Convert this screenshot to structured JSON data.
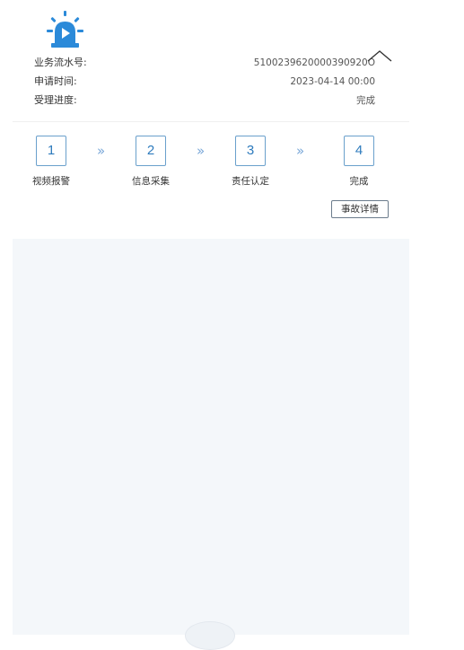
{
  "header": {
    "icon": "siren-icon",
    "accent_color": "#2b8ad9"
  },
  "info": {
    "serial_label": "业务流水号:",
    "serial_value": "5100239620000390920O",
    "time_label": "申请时间:",
    "time_value": "2023-04-14 00:00",
    "progress_label": "受理进度:",
    "progress_value": "完成"
  },
  "collapse": {
    "icon": "chevron-up-icon"
  },
  "steps": [
    {
      "number": "1",
      "label": "视频报警"
    },
    {
      "number": "2",
      "label": "信息采集"
    },
    {
      "number": "3",
      "label": "责任认定"
    },
    {
      "number": "4",
      "label": "完成"
    }
  ],
  "step_separator": "»",
  "detail_button": {
    "label": "事故详情"
  }
}
